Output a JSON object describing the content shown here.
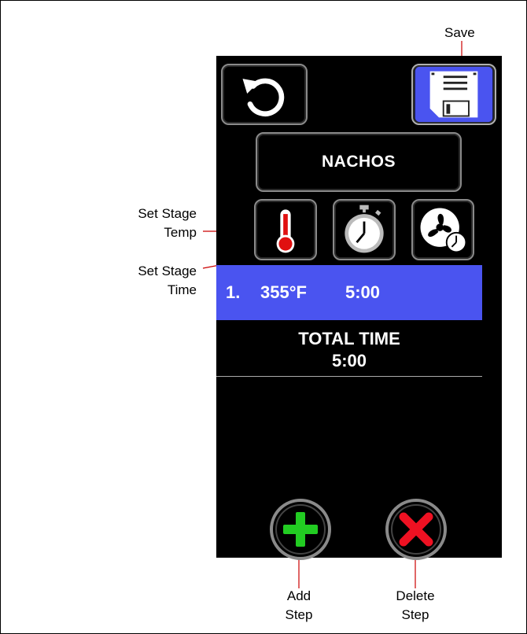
{
  "callouts": {
    "save": "Save",
    "set_stage_temp_line1": "Set Stage",
    "set_stage_temp_line2": "Temp",
    "set_stage_time_line1": "Set Stage",
    "set_stage_time_line2": "Time",
    "add_step_line1": "Add",
    "add_step_line2": "Step",
    "delete_step_line1": "Delete",
    "delete_step_line2": "Step"
  },
  "recipe": {
    "name": "NACHOS"
  },
  "steps": [
    {
      "number": "1.",
      "temperature": "355°F",
      "time": "5:00"
    }
  ],
  "total": {
    "label": "TOTAL TIME",
    "value": "5:00"
  },
  "icons": [
    "reset-icon",
    "save-disk-icon",
    "thermometer-icon",
    "stopwatch-icon",
    "fan-timer-icon",
    "plus-icon",
    "x-icon"
  ],
  "colors": {
    "screen_bg": "#000000",
    "selected_row": "#4a54f0",
    "save_tile": "#4a54f0",
    "add_green": "#22cc22",
    "delete_red": "#ee1122",
    "leader_line": "#cc0000"
  }
}
